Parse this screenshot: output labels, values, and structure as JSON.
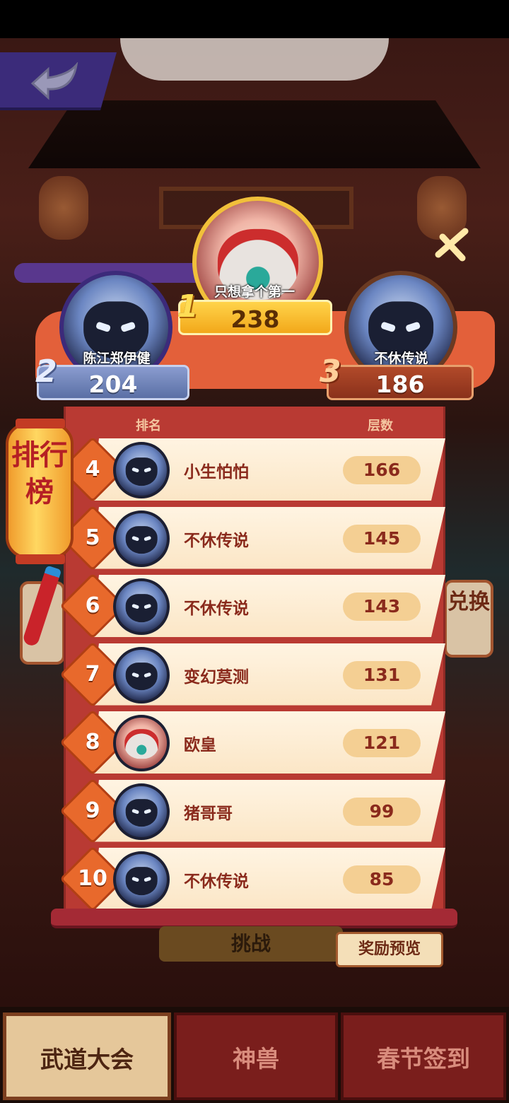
{
  "podium": {
    "first": {
      "rank": "1",
      "name": "只想拿个第一",
      "score": "238"
    },
    "second": {
      "rank": "2",
      "name": "陈江郑伊健",
      "score": "204"
    },
    "third": {
      "rank": "3",
      "name": "不休传说",
      "score": "186"
    }
  },
  "panel": {
    "header_rank": "排名",
    "header_floors": "层数",
    "rows": [
      {
        "rank": "4",
        "name": "小生怕怕",
        "score": "166",
        "avatar": "ninja"
      },
      {
        "rank": "5",
        "name": "不休传说",
        "score": "145",
        "avatar": "ninja"
      },
      {
        "rank": "6",
        "name": "不休传说",
        "score": "143",
        "avatar": "ninja"
      },
      {
        "rank": "7",
        "name": "变幻莫测",
        "score": "131",
        "avatar": "ninja"
      },
      {
        "rank": "8",
        "name": "欧皇",
        "score": "121",
        "avatar": "lion"
      },
      {
        "rank": "9",
        "name": "猪哥哥",
        "score": "99",
        "avatar": "ninja"
      },
      {
        "rank": "10",
        "name": "不休传说",
        "score": "85",
        "avatar": "ninja"
      }
    ]
  },
  "side_banner": {
    "label": "排行榜"
  },
  "side_tab_right": {
    "label": "兑换"
  },
  "buttons": {
    "challenge": "挑战",
    "reward_preview": "奖励预览"
  },
  "tabs": [
    {
      "label": "武道大会",
      "active": true
    },
    {
      "label": "神兽",
      "active": false
    },
    {
      "label": "春节签到",
      "active": false
    }
  ],
  "icons": {
    "back": "back-arrow-icon",
    "close": "close-icon"
  }
}
